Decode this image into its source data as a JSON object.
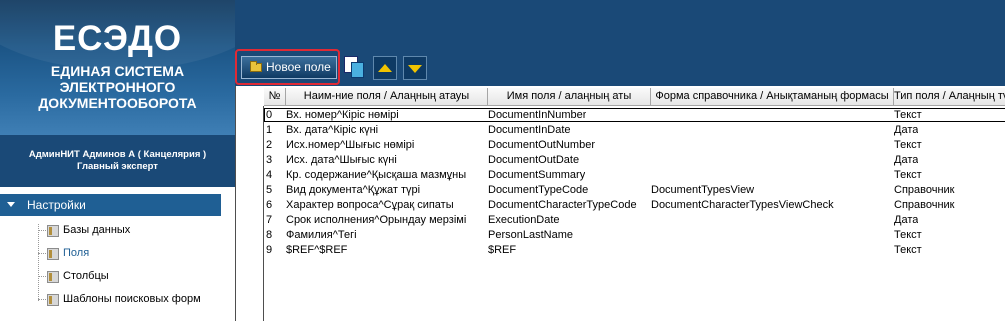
{
  "brand": {
    "title": "ЕСЭДО",
    "subtitle_lines": [
      "ЕДИНАЯ СИСТЕМА",
      "ЭЛЕКТРОННОГО",
      "ДОКУМЕНТООБОРОТА"
    ]
  },
  "user": {
    "name": "АдминНИТ Админов А ( Канцелярия )",
    "role": "Главный эксперт"
  },
  "tree": {
    "header": "Настройки",
    "items": [
      {
        "label": "Базы данных"
      },
      {
        "label": "Поля"
      },
      {
        "label": "Столбцы"
      },
      {
        "label": "Шаблоны поисковых форм"
      }
    ]
  },
  "toolbar": {
    "add_label": "Новое поле"
  },
  "grid": {
    "columns": [
      "№",
      "Наим-ние поля / Алаңның атауы",
      "Имя поля / алаңның аты",
      "Форма справочника / Анықтаманың формасы",
      "Тип поля / Алаңның түрі"
    ],
    "rows": [
      [
        "0",
        "Вх. номер^Кіріс нөмірі",
        "DocumentInNumber",
        "",
        "Текст"
      ],
      [
        "1",
        "Вх. дата^Кіріс күні",
        "DocumentInDate",
        "",
        "Дата"
      ],
      [
        "2",
        "Исх.номер^Шығыс нөмірі",
        "DocumentOutNumber",
        "",
        "Текст"
      ],
      [
        "3",
        "Исх. дата^Шығыс күні",
        "DocumentOutDate",
        "",
        "Дата"
      ],
      [
        "4",
        "Кр. содержание^Қысқаша мазмұны",
        "DocumentSummary",
        "",
        "Текст"
      ],
      [
        "5",
        "Вид документа^Құжат түрі",
        "DocumentTypeCode",
        "DocumentTypesView",
        "Справочник"
      ],
      [
        "6",
        "Характер вопроса^Сұрақ сипаты",
        "DocumentCharacterTypeCode",
        "DocumentCharacterTypesViewCheck",
        "Справочник"
      ],
      [
        "7",
        "Срок исполнения^Орындау мерзімі",
        "ExecutionDate",
        "",
        "Дата"
      ],
      [
        "8",
        "Фамилия^Тегі",
        "PersonLastName",
        "",
        "Текст"
      ],
      [
        "9",
        "$REF^$REF",
        "$REF",
        "",
        "Текст"
      ]
    ]
  }
}
